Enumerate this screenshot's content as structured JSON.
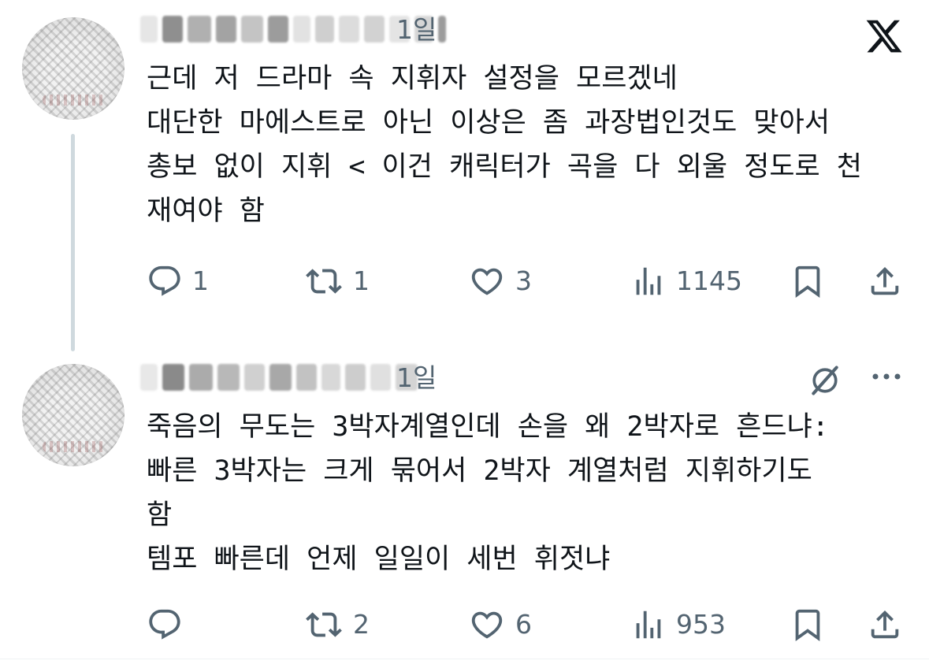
{
  "tweets": [
    {
      "time": "1일",
      "text": "근데 저 드라마 속 지휘자 설정을 모르겠네\n대단한 마에스트로 아닌 이상은 좀 과장법인것도 맞아서\n총보 없이 지휘 < 이건 캐릭터가 곡을 다 외울 정도로 천\n재여야 함",
      "replies": "1",
      "reposts": "1",
      "likes": "3",
      "views": "1145"
    },
    {
      "time": "1일",
      "text": "죽음의 무도는 3박자계열인데 손을 왜 2박자로 흔드냐:\n빠른 3박자는 크게 묶어서 2박자 계열처럼 지휘하기도\n함\n템포 빠른데 언제 일일이 세번 휘젓냐",
      "replies": "",
      "reposts": "2",
      "likes": "6",
      "views": "953"
    }
  ],
  "icons": {
    "close": "x-logo-icon",
    "grok": "grok-icon",
    "more": "more-icon",
    "reply": "reply-icon",
    "repost": "repost-icon",
    "like": "heart-icon",
    "views": "views-icon",
    "bookmark": "bookmark-icon",
    "share": "share-icon"
  },
  "colors": {
    "text": "#0f1419",
    "secondary": "#536471",
    "thread_line": "#cfd9de",
    "blur_dark": "#9a9a9a",
    "blur_light": "#d9d9d9"
  }
}
